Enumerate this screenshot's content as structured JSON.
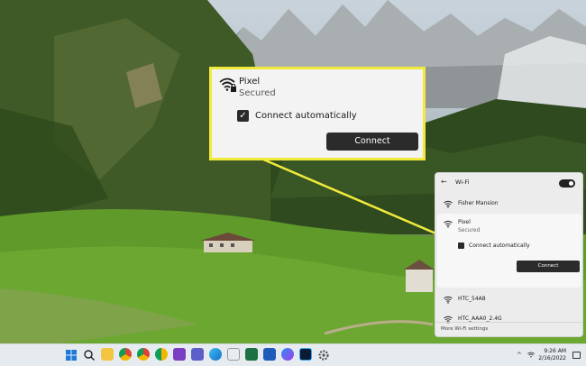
{
  "callout": {
    "network_name": "Pixel",
    "network_status": "Secured",
    "connect_auto_label": "Connect automatically",
    "connect_button": "Connect",
    "connect_auto_checked": true
  },
  "flyout": {
    "title": "Wi-Fi",
    "wifi_enabled": true,
    "networks": [
      {
        "name": "Fisher Mansion"
      },
      {
        "name": "Pixel",
        "status": "Secured",
        "selected": true
      },
      {
        "name": "HTC_54A8"
      },
      {
        "name": "HTC_AAA0_2.4G"
      }
    ],
    "connect_auto_label": "Connect automatically",
    "connect_button": "Connect",
    "footer_link": "More Wi-Fi settings"
  },
  "taskbar": {
    "time": "9:26 AM",
    "date": "2/16/2022",
    "pinned_icons": [
      "windows-start",
      "search",
      "file-explorer",
      "chrome",
      "edge",
      "browser-extension",
      "onenote",
      "teams",
      "edge-dev",
      "store",
      "excel",
      "word",
      "messenger",
      "photoshop",
      "settings"
    ]
  },
  "colors": {
    "callout_border": "#f1ea3c",
    "connector_line": "#f1ea3c",
    "button_bg": "#2b2b2b"
  }
}
